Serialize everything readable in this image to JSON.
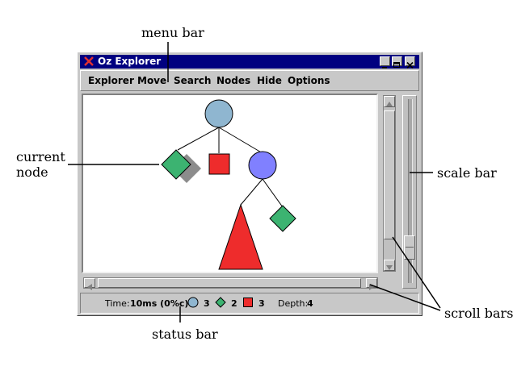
{
  "annotations": {
    "menu_bar": "menu bar",
    "current_node_line1": "current",
    "current_node_line2": "node",
    "scale_bar": "scale bar",
    "scroll_bars": "scroll bars",
    "status_bar": "status bar"
  },
  "window": {
    "title": "Oz Explorer",
    "menu": [
      "Explorer",
      "Move",
      "Search",
      "Nodes",
      "Hide",
      "Options"
    ]
  },
  "tree": {
    "colors": {
      "choice": "#8fb6d0",
      "current_choice": "#8080ff",
      "solved": "#3cb371",
      "failed": "#ee2c2c",
      "shadow": "#8c8c8c"
    }
  },
  "status": {
    "time_label": "Time:",
    "time_value": "10ms (0%c)",
    "choice_count": "3",
    "solved_count": "2",
    "failed_count": "3",
    "depth_label": "Depth:",
    "depth_value": "4"
  }
}
